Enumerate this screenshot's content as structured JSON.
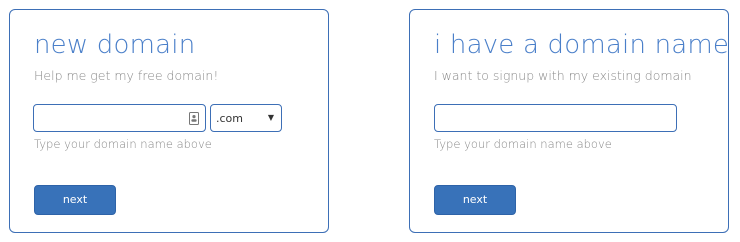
{
  "colors": {
    "accent": "#3d6fb6",
    "title_text": "#4a7fc9",
    "muted_text": "#8a8a8a",
    "button_bg": "#3872b9",
    "button_text": "#ffffff"
  },
  "new_domain": {
    "title": "new domain",
    "subtitle": "Help me get my free domain!",
    "domain_input": {
      "value": "",
      "placeholder": "",
      "icon": "autofill-contact-card-icon"
    },
    "tld_select": {
      "selected": ".com",
      "arrow_icon": "dropdown-arrow-icon"
    },
    "help_text": "Type your domain name above",
    "next_label": "next"
  },
  "existing_domain": {
    "title": "i have a domain name",
    "subtitle": "I want to signup with my existing domain",
    "domain_input": {
      "value": "",
      "placeholder": ""
    },
    "help_text": "Type your domain name above",
    "next_label": "next"
  }
}
